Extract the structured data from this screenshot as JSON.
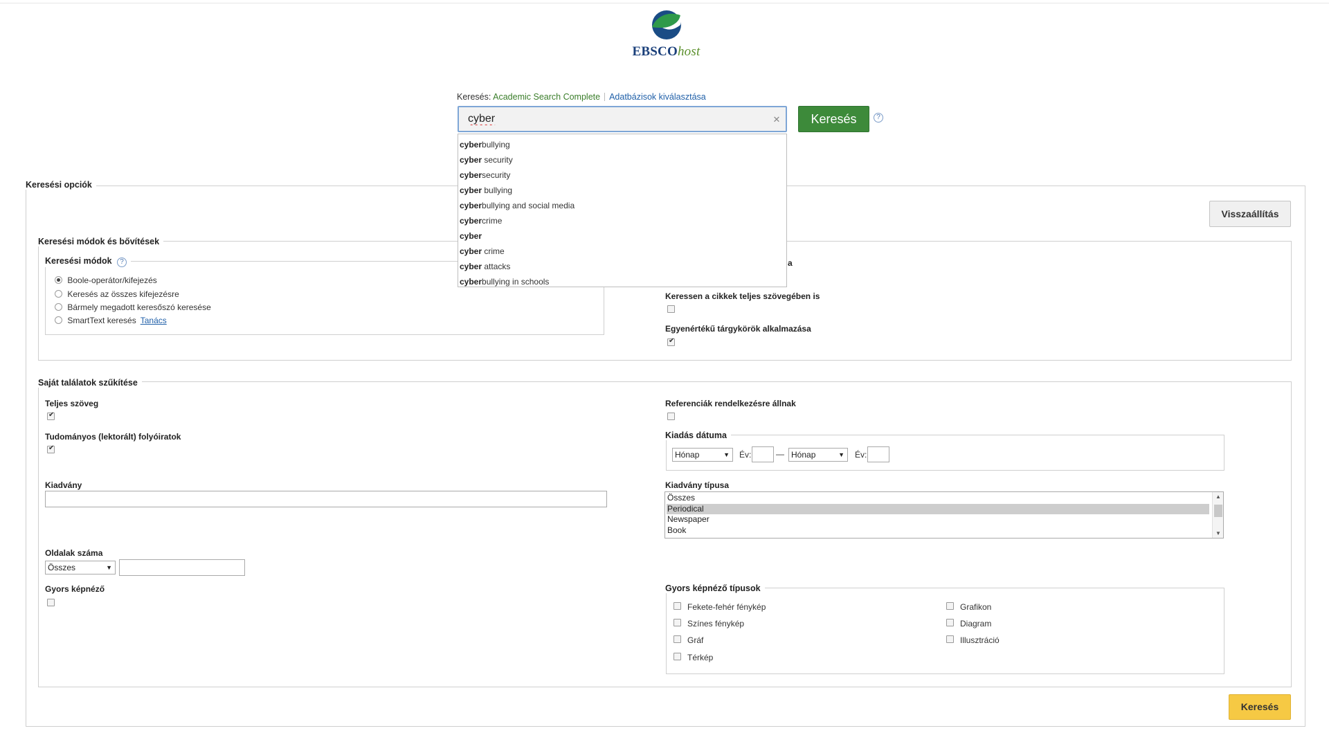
{
  "logo": {
    "brand": "EBSCO",
    "suffix": "host"
  },
  "search": {
    "db_prefix": "Keresés:",
    "db_name": "Academic Search Complete",
    "choose_db": "Adatbázisok kiválasztása",
    "query": "cyber",
    "clear_symbol": "✕",
    "button": "Keresés",
    "help": "?"
  },
  "autocomplete": [
    {
      "bold": "cyber",
      "rest": "bullying"
    },
    {
      "bold": "cyber",
      "rest": " security"
    },
    {
      "bold": "cyber",
      "rest": "security"
    },
    {
      "bold": "cyber",
      "rest": " bullying"
    },
    {
      "bold": "cyber",
      "rest": "bullying and social media"
    },
    {
      "bold": "cyber",
      "rest": "crime"
    },
    {
      "bold": "cyber",
      "rest": ""
    },
    {
      "bold": "cyber",
      "rest": " crime"
    },
    {
      "bold": "cyber",
      "rest": " attacks"
    },
    {
      "bold": "cyber",
      "rest": "bullying in schools"
    }
  ],
  "options": {
    "legend": "Keresési opciók",
    "reset": "Visszaállítás",
    "modes": {
      "legend": "Keresési módok és bővítések",
      "sub_legend": "Keresési módok",
      "help": "?",
      "items": [
        {
          "label": "Boole-operátor/kifejezés",
          "selected": true
        },
        {
          "label": "Keresés az összes kifejezésre",
          "selected": false
        },
        {
          "label": "Bármely megadott keresőszó keresése",
          "selected": false
        },
        {
          "label": "SmartText keresés",
          "selected": false
        }
      ],
      "tip_link": "Tanács",
      "partial_label_tail": "a",
      "fulltext_label": "Keressen a cikkek teljes szövegében is",
      "fulltext_checked": false,
      "equiv_label": "Egyenértékű tárgykörök alkalmazása",
      "equiv_checked": true
    }
  },
  "limits": {
    "legend": "Saját találatok szűkítése",
    "full_text": {
      "label": "Teljes szöveg",
      "checked": true
    },
    "peer_reviewed": {
      "label": "Tudományos (lektorált) folyóiratok",
      "checked": true
    },
    "references": {
      "label": "Referenciák rendelkezésre állnak",
      "checked": false
    },
    "pub_date": {
      "label": "Kiadás dátuma",
      "month_from": "Hónap",
      "year_label_from": "Év:",
      "dash": "—",
      "month_to": "Hónap",
      "year_label_to": "Év:"
    },
    "publication": {
      "label": "Kiadvány",
      "value": ""
    },
    "pub_type": {
      "label": "Kiadvány típusa",
      "options": [
        "Összes",
        "Periodical",
        "Newspaper",
        "Book"
      ],
      "selected_index": 1
    },
    "pages": {
      "label": "Oldalak száma",
      "select": "Összes",
      "value": ""
    },
    "quick_image": {
      "label": "Gyors képnéző",
      "checked": false
    },
    "image_types": {
      "legend": "Gyors képnéző típusok",
      "col1": [
        "Fekete-fehér fénykép",
        "Színes fénykép",
        "Gráf",
        "Térkép"
      ],
      "col2": [
        "Grafikon",
        "Diagram",
        "Illusztráció"
      ]
    }
  },
  "bottom_button": "Keresés",
  "colors": {
    "search_green": "#3d8a3a",
    "db_green": "#3a7d2a",
    "link_blue": "#1f5fa8",
    "search_border": "#7ea6d6",
    "bottom_yellow": "#f6c944"
  }
}
